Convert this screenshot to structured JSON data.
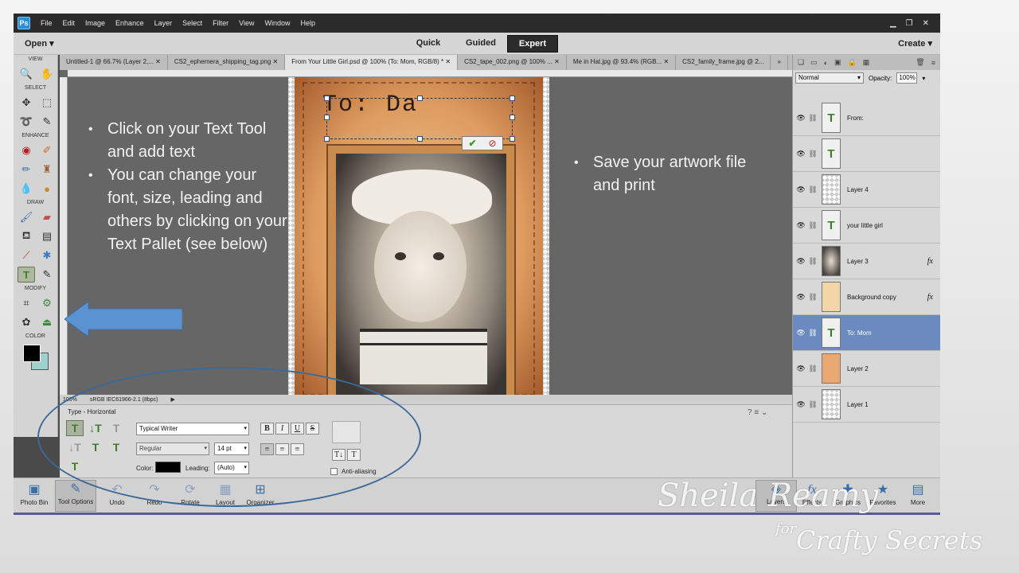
{
  "menubar": {
    "logo": "",
    "items": [
      "File",
      "Edit",
      "Image",
      "Enhance",
      "Layer",
      "Select",
      "Filter",
      "View",
      "Window",
      "Help"
    ],
    "controls": [
      "▁",
      "❐",
      "✕"
    ]
  },
  "modebar": {
    "open_label": "Open",
    "modes": [
      "Quick",
      "Guided",
      "Expert"
    ],
    "active_mode": "Expert",
    "create_label": "Create"
  },
  "toolbox": {
    "sections": [
      "VIEW",
      "SELECT",
      "ENHANCE",
      "DRAW",
      "MODIFY",
      "COLOR"
    ],
    "foreground_color": "#000000",
    "background_color": "#9fd0ce",
    "selected_tool": "type-tool"
  },
  "tabs": [
    "Untitled-1 @ 66.7% (Layer 2,...",
    "CS2_ephemera_shipping_tag.png",
    "From Your Little Girl.psd @ 100% (To: Mom, RGB/8) *",
    "CS2_tape_002.png @ 100% ...",
    "Me in Hat.jpg @ 93.4% (RGB...",
    "CS2_family_frame.jpg @ 2..."
  ],
  "active_tab_index": 2,
  "canvas": {
    "text_on_tag": "To: Da",
    "left_bullets": [
      "Click on your Text Tool and add text",
      "You can change your font, size, leading and others by clicking on your Text Pallet (see below)"
    ],
    "right_bullets": [
      "Save your artwork file and print"
    ]
  },
  "statusbar": {
    "zoom": "100%",
    "profile": "sRGB IEC61966-2.1 (8bpc)"
  },
  "tool_options": {
    "title": "Type - Horizontal",
    "font": "Typical Writer",
    "style": "Regular",
    "size": "14 pt",
    "color_label": "Color:",
    "leading_label": "Leading:",
    "leading_value": "(Auto)",
    "format_buttons": [
      "B",
      "I",
      "U",
      "S"
    ],
    "anti_aliasing_label": "Anti-aliasing"
  },
  "layers_panel": {
    "blend_mode": "Normal",
    "opacity_label": "Opacity:",
    "opacity_value": "100%",
    "layers": [
      {
        "name": "From:",
        "thumb": "T",
        "fx": ""
      },
      {
        "name": "",
        "thumb": "T",
        "fx": ""
      },
      {
        "name": "Layer 4",
        "thumb": "",
        "fx": ""
      },
      {
        "name": "your little girl",
        "thumb": "T",
        "fx": ""
      },
      {
        "name": "Layer 3",
        "thumb": "",
        "fx": "fx"
      },
      {
        "name": "Background copy",
        "thumb": "",
        "fx": "fx"
      },
      {
        "name": "To: Mom",
        "thumb": "T",
        "fx": ""
      },
      {
        "name": "Layer 2",
        "thumb": "",
        "fx": ""
      },
      {
        "name": "Layer 1",
        "thumb": "",
        "fx": ""
      }
    ],
    "selected_layer": "To: Mom"
  },
  "bottombar": {
    "left": [
      "Photo Bin",
      "Tool Options",
      "Undo",
      "Redo",
      "Rotate",
      "Layout",
      "Organizer"
    ],
    "right": [
      "Layers",
      "Effects",
      "Graphics",
      "Favorites",
      "More"
    ]
  },
  "watermark": {
    "line1": "Sheila Reamy",
    "for": "for",
    "line2": "Crafty Secrets"
  },
  "colors": {
    "highlight_ellipse": "#3b6a9a",
    "arrow": "#5b93d0",
    "selected_layer": "#6a8ac0"
  }
}
